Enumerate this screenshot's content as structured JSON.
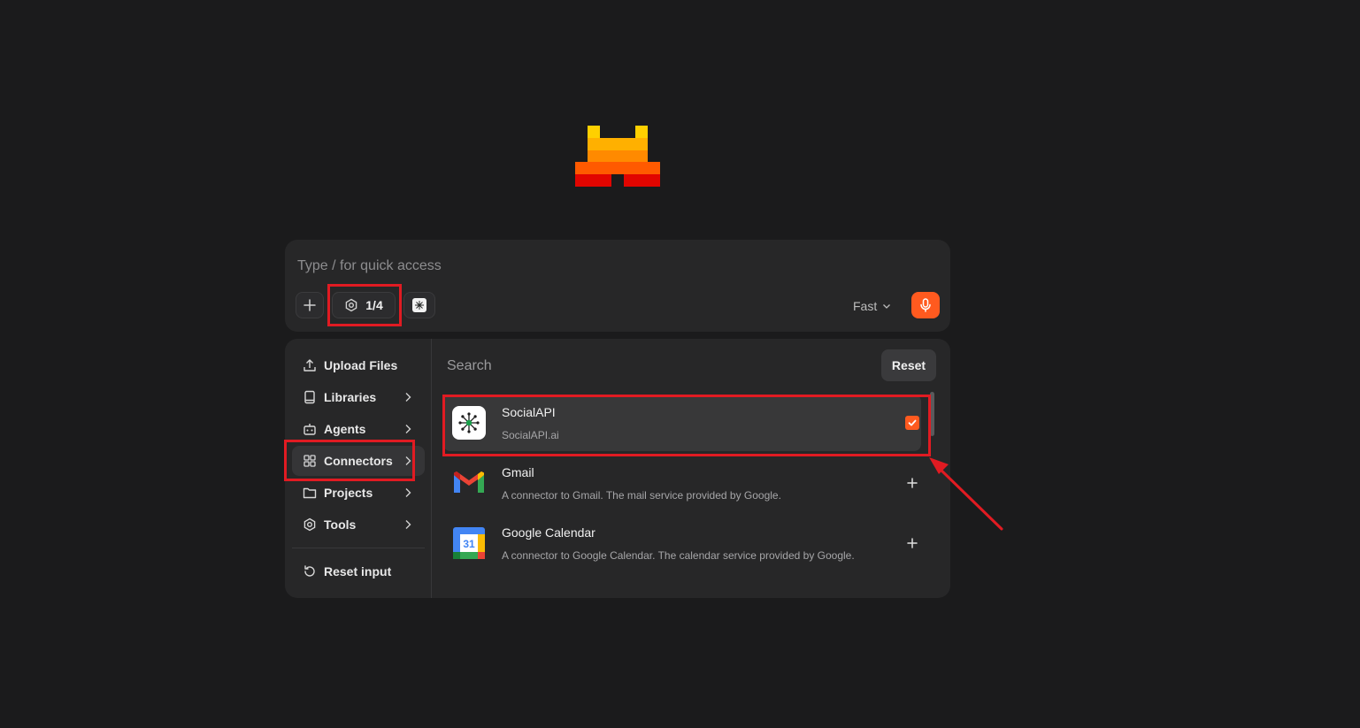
{
  "composer": {
    "placeholder": "Type / for quick access",
    "tools_count": "1/4",
    "mode": "Fast"
  },
  "menu": {
    "items": [
      {
        "label": "Upload Files",
        "icon": "upload-icon"
      },
      {
        "label": "Libraries",
        "icon": "book-icon"
      },
      {
        "label": "Agents",
        "icon": "robot-icon"
      },
      {
        "label": "Connectors",
        "icon": "grid-icon"
      },
      {
        "label": "Projects",
        "icon": "folder-icon"
      },
      {
        "label": "Tools",
        "icon": "gear-icon"
      }
    ],
    "reset_label": "Reset input"
  },
  "connectors": {
    "search_placeholder": "Search",
    "reset_label": "Reset",
    "items": [
      {
        "name": "SocialAPI",
        "description": "SocialAPI.ai",
        "selected": true,
        "icon": "socialapi-logo"
      },
      {
        "name": "Gmail",
        "description": "A connector to Gmail. The mail service provided by Google.",
        "selected": false,
        "icon": "gmail-logo"
      },
      {
        "name": "Google Calendar",
        "description": "A connector to Google Calendar. The calendar service provided by Google.",
        "selected": false,
        "icon": "google-calendar-logo",
        "icon_text": "31"
      }
    ]
  },
  "colors": {
    "accent": "#ff5a1f",
    "highlight": "#e11b22",
    "background": "#1b1b1c",
    "panel": "#272728"
  }
}
